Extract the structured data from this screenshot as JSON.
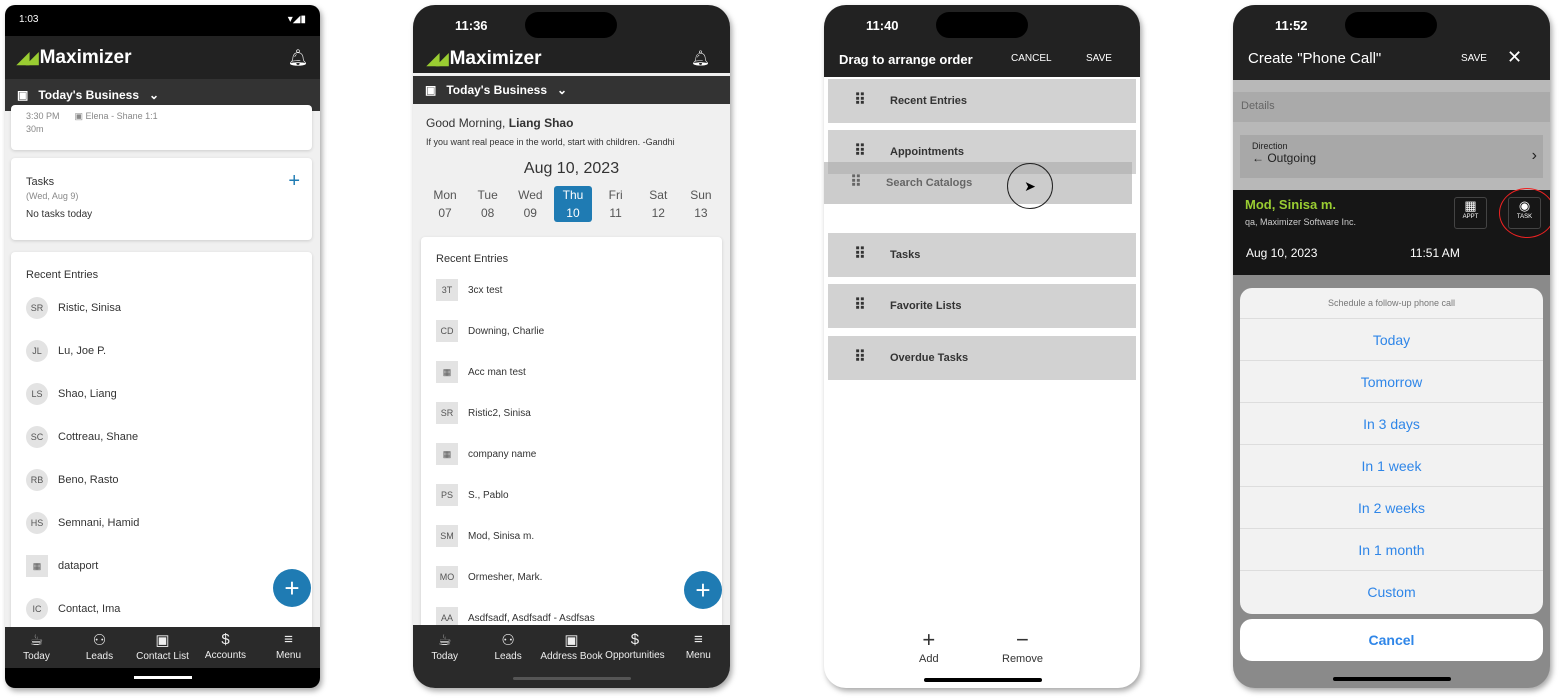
{
  "brand": {
    "name": "Maximizer",
    "accent": "#9acd32",
    "blue": "#1f7bb3"
  },
  "phone1": {
    "status_time": "1:03",
    "subheader": "Today's Business",
    "appt_partial": {
      "time": "3:30 PM",
      "title": "Elena - Shane 1:1",
      "duration": "30m"
    },
    "tasks": {
      "title": "Tasks",
      "date": "(Wed, Aug 9)",
      "empty": "No tasks today"
    },
    "recent": {
      "title": "Recent Entries",
      "items": [
        {
          "initials": "SR",
          "name": "Ristic, Sinisa"
        },
        {
          "initials": "JL",
          "name": "Lu, Joe P."
        },
        {
          "initials": "LS",
          "name": "Shao, Liang"
        },
        {
          "initials": "SC",
          "name": "Cottreau, Shane"
        },
        {
          "initials": "RB",
          "name": "Beno, Rasto"
        },
        {
          "initials": "HS",
          "name": "Semnani, Hamid"
        },
        {
          "initials": "▦",
          "name": "dataport"
        },
        {
          "initials": "IC",
          "name": "Contact, Ima"
        }
      ]
    },
    "nav": [
      "Today",
      "Leads",
      "Contact List",
      "Accounts",
      "Menu"
    ]
  },
  "phone2": {
    "status_time": "11:36",
    "subheader": "Today's Business",
    "greeting": "Good Morning,",
    "user": "Liang Shao",
    "quote": "If you want real peace in the world, start with children. -Gandhi",
    "date": "Aug 10, 2023",
    "week": [
      {
        "d": "Mon",
        "n": "07"
      },
      {
        "d": "Tue",
        "n": "08"
      },
      {
        "d": "Wed",
        "n": "09"
      },
      {
        "d": "Thu",
        "n": "10",
        "selected": true
      },
      {
        "d": "Fri",
        "n": "11"
      },
      {
        "d": "Sat",
        "n": "12"
      },
      {
        "d": "Sun",
        "n": "13"
      }
    ],
    "recent": {
      "title": "Recent Entries",
      "items": [
        {
          "initials": "3T",
          "name": "3cx test"
        },
        {
          "initials": "CD",
          "name": "Downing, Charlie"
        },
        {
          "initials": "▦",
          "name": "Acc man test"
        },
        {
          "initials": "SR",
          "name": "Ristic2, Sinisa"
        },
        {
          "initials": "▦",
          "name": "company name"
        },
        {
          "initials": "PS",
          "name": "S., Pablo"
        },
        {
          "initials": "SM",
          "name": "Mod, Sinisa m."
        },
        {
          "initials": "MO",
          "name": "Ormesher, Mark."
        },
        {
          "initials": "AA",
          "name": "Asdfsadf, Asdfsadf - Asdfsas"
        }
      ]
    },
    "nav": [
      "Today",
      "Leads",
      "Address Book",
      "Opportunities",
      "Menu"
    ]
  },
  "phone3": {
    "status_time": "11:40",
    "title": "Drag to arrange order",
    "cancel": "CANCEL",
    "save": "SAVE",
    "items": [
      "Recent Entries",
      "Appointments",
      "Tasks",
      "Favorite Lists",
      "Overdue Tasks"
    ],
    "dragging": "Search Catalogs",
    "add": "Add",
    "remove": "Remove"
  },
  "phone4": {
    "status_time": "11:52",
    "title": "Create \"Phone Call\"",
    "save": "SAVE",
    "details": "Details",
    "direction_label": "Direction",
    "direction_value": "← Outgoing",
    "contact": "Mod, Sinisa m.",
    "company": "qa, Maximizer Software Inc.",
    "appt": "APPT",
    "task": "TASK",
    "date": "Aug 10, 2023",
    "time": "11:51 AM",
    "sheet_title": "Schedule a follow-up phone call",
    "options": [
      "Today",
      "Tomorrow",
      "In 3 days",
      "In 1 week",
      "In 2 weeks",
      "In 1 month",
      "Custom"
    ],
    "cancel": "Cancel"
  }
}
